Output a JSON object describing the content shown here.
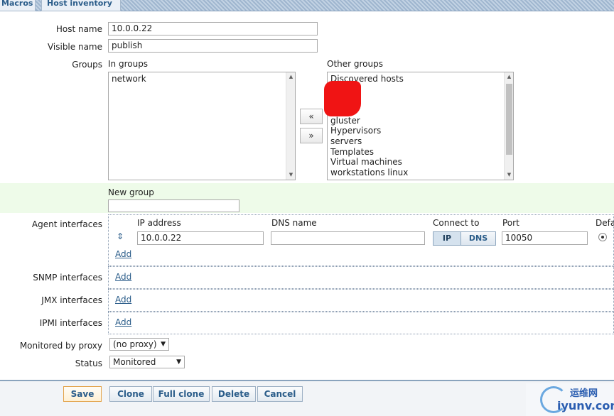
{
  "tabs": [
    {
      "label": "Macros"
    },
    {
      "label": "Host inventory"
    }
  ],
  "host": {
    "host_name_label": "Host name",
    "host_name_value": "10.0.0.22",
    "visible_name_label": "Visible name",
    "visible_name_value": "publish"
  },
  "groups": {
    "label": "Groups",
    "in_groups_label": "In groups",
    "in_groups": [
      "network"
    ],
    "other_groups_label": "Other groups",
    "other_groups": [
      "Discovered hosts",
      "gluster",
      "Hypervisors",
      "servers",
      "Templates",
      "Virtual machines",
      "workstations linux"
    ],
    "move_left": "«",
    "move_right": "»"
  },
  "new_group": {
    "label": "New group",
    "value": ""
  },
  "agent": {
    "label": "Agent interfaces",
    "col_ip": "IP address",
    "col_dns": "DNS name",
    "col_connect": "Connect to",
    "col_port": "Port",
    "col_default": "Defa",
    "ip_value": "10.0.0.22",
    "dns_value": "",
    "connect_ip": "IP",
    "connect_dns": "DNS",
    "port_value": "10050",
    "add": "Add"
  },
  "snmp": {
    "label": "SNMP interfaces",
    "add": "Add"
  },
  "jmx": {
    "label": "JMX interfaces",
    "add": "Add"
  },
  "ipmi": {
    "label": "IPMI interfaces",
    "add": "Add"
  },
  "proxy": {
    "label": "Monitored by proxy",
    "value": "(no proxy)"
  },
  "status": {
    "label": "Status",
    "value": "Monitored"
  },
  "buttons": {
    "save": "Save",
    "clone": "Clone",
    "full_clone": "Full clone",
    "delete": "Delete",
    "cancel": "Cancel"
  },
  "watermark": {
    "cn": "运维网",
    "url": "iyunv.com"
  },
  "colors": {
    "accent": "#2b5d8a",
    "green_row": "#eefbe9",
    "save_border": "#e3a34a",
    "redaction": "#f01414"
  }
}
